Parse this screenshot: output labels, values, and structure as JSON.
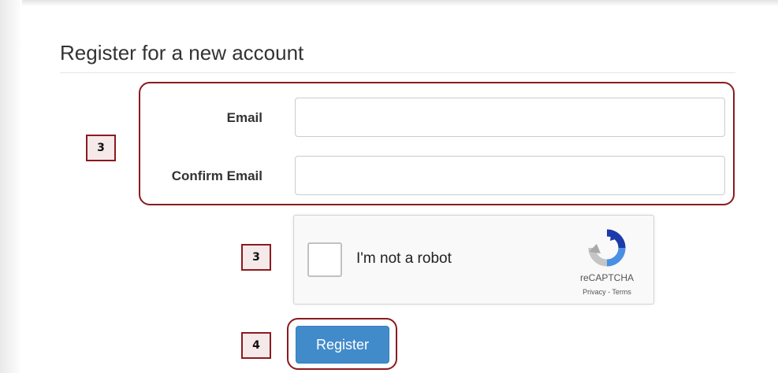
{
  "form": {
    "title": "Register for a new account",
    "email_label": "Email",
    "email_value": "",
    "confirm_email_label": "Confirm Email",
    "confirm_email_value": "",
    "register_button": "Register"
  },
  "recaptcha": {
    "checkbox_label": "I'm not a robot",
    "brand": "reCAPTCHA",
    "links": "Privacy - Terms",
    "checked": false
  },
  "annotations": {
    "fields_step": "3",
    "captcha_step": "3",
    "register_step": "4"
  },
  "colors": {
    "callout": "#8b1a1f",
    "badge_bg": "#f6e9e9",
    "button": "#428bca"
  }
}
